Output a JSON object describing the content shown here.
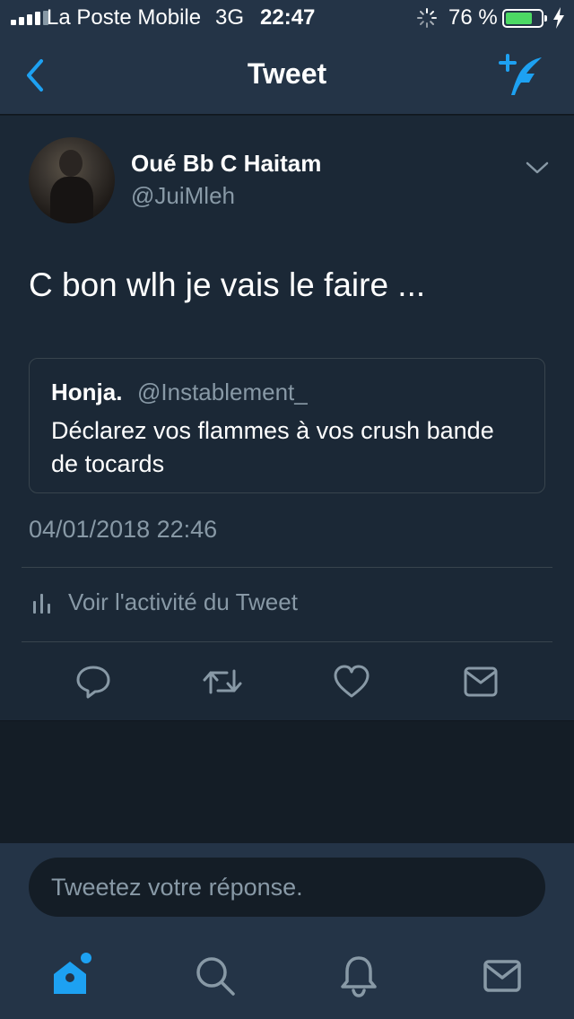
{
  "status_bar": {
    "carrier": "La Poste Mobile",
    "network": "3G",
    "time": "22:47",
    "battery_percent": "76 %",
    "battery_level": 0.76,
    "signal_bars": 4,
    "signal_bars_total": 5,
    "icons": [
      "signal-icon",
      "activity-spinner-icon",
      "battery-icon",
      "charging-bolt-icon"
    ]
  },
  "nav": {
    "title": "Tweet",
    "back_icon": "chevron-left-icon",
    "compose_icon": "compose-tweet-icon"
  },
  "tweet": {
    "author_name": "Oué Bb C Haitam",
    "author_handle": "@JuiMleh",
    "text": "C bon wlh je vais le faire ...",
    "quote": {
      "name": "Honja.",
      "handle": "@Instablement_",
      "text": "Déclarez vos flammes à vos crush bande de tocards"
    },
    "timestamp": "04/01/2018 22:46",
    "activity_label": "Voir l'activité du Tweet",
    "actions": [
      "reply-icon",
      "retweet-icon",
      "like-icon",
      "message-icon"
    ]
  },
  "reply": {
    "placeholder": "Tweetez votre réponse."
  },
  "tabs": [
    "home-icon",
    "search-icon",
    "notifications-icon",
    "messages-icon"
  ],
  "colors": {
    "accent": "#1da1f2",
    "background": "#141d26",
    "card": "#1b2836",
    "bar": "#243447",
    "secondary_text": "#8899a6",
    "battery": "#4cd964"
  }
}
